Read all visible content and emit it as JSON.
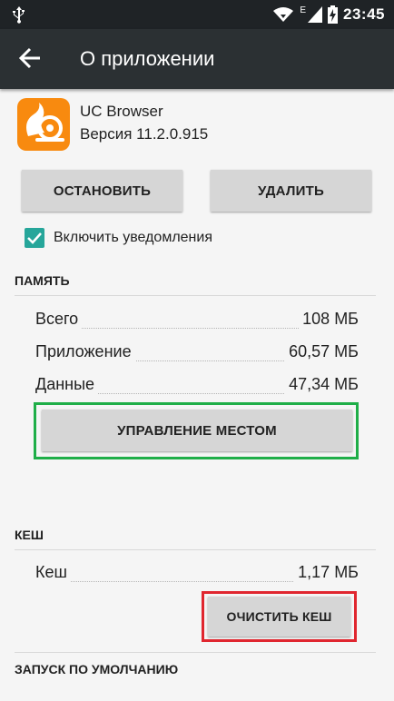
{
  "status_bar": {
    "time": "23:45",
    "network_type": "E",
    "icons": [
      "usb-icon",
      "wifi-icon",
      "signal-icon",
      "battery-charging-icon"
    ]
  },
  "app_bar": {
    "title": "О приложении",
    "back_icon": "arrow-back-icon"
  },
  "app": {
    "name": "UC Browser",
    "version": "Версия 11.2.0.915",
    "icon": "uc-browser-squirrel-icon",
    "icon_color": "#f88a0f"
  },
  "actions": {
    "stop_label": "ОСТАНОВИТЬ",
    "delete_label": "УДАЛИТЬ"
  },
  "notifications": {
    "label": "Включить уведомления",
    "checked": true
  },
  "memory": {
    "header": "ПАМЯТЬ",
    "rows": [
      {
        "label": "Всего",
        "value": "108 МБ"
      },
      {
        "label": "Приложение",
        "value": "60,57 МБ"
      },
      {
        "label": "Данные",
        "value": "47,34 МБ"
      }
    ],
    "manage_label": "УПРАВЛЕНИЕ МЕСТОМ"
  },
  "cache": {
    "header": "КЕШ",
    "rows": [
      {
        "label": "Кеш",
        "value": "1,17 МБ"
      }
    ],
    "clear_label": "ОЧИСТИТЬ КЕШ"
  },
  "launch": {
    "header": "ЗАПУСК ПО УМОЛЧАНИЮ"
  },
  "colors": {
    "accent": "#26a69a",
    "highlight_green": "#1fae48",
    "highlight_red": "#e0262f",
    "app_bar": "#2b3033"
  }
}
